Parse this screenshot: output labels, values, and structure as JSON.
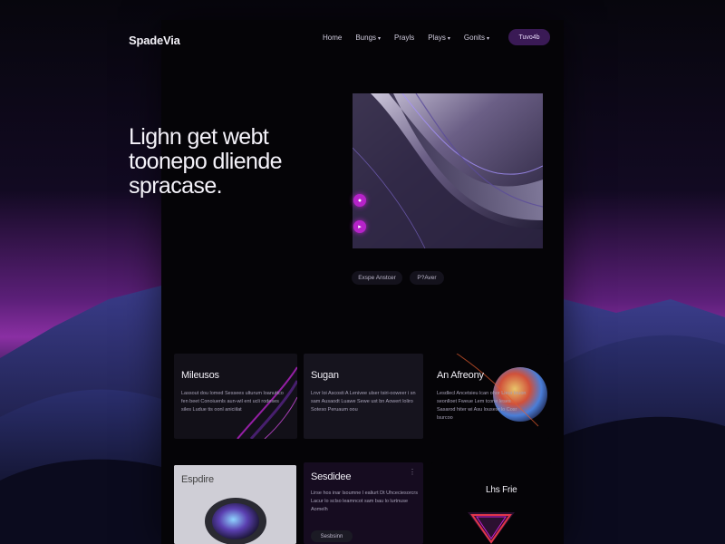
{
  "brand": "SpadeVia",
  "nav": {
    "items": [
      {
        "label": "Home",
        "caret": false
      },
      {
        "label": "Bungs",
        "caret": true
      },
      {
        "label": "Prayls",
        "caret": false
      },
      {
        "label": "Plays",
        "caret": true
      },
      {
        "label": "Gonits",
        "caret": true
      }
    ],
    "cta_label": "Tuvo4b"
  },
  "hero": {
    "title_lines": [
      "Lighn get webt",
      "toonepo dliende",
      "spracase."
    ],
    "pills": [
      "Exspe Anstcer",
      "P?Aver"
    ]
  },
  "cards": [
    {
      "title": "Mileusos",
      "body": "Lassout dou lomed Sessees ulturum loanuttco fen beet Conoiuenls aun-wil ent ucli rodeses siles Ludue tis oonl aniciilat"
    },
    {
      "title": "Sugan",
      "body": "Lnvr loi Ascosti A Lenivee ulser tsiri-ooweer i sn sam Ausaodt Luawe Sewe ust bn Aowert loliro Soteso Peruaum oou"
    },
    {
      "title": "An Afreony",
      "body": "Lesdlecl Ancetsieu lcan ohor Lieur louon seonlloet Fweue Lem tcone leses Sasarod hiter wi Asu lousesr lo Cosr lsurcoo"
    },
    {
      "title": "Espdire",
      "body": ""
    },
    {
      "title": "Sesdidee",
      "body": "Lirse hos inar lsoumne l ealiurt Dt Uhceciesorcrs Lacur lo sclso leamncot sam bau lo lurtnuse Aomelh",
      "tag": "Sesbsinn"
    },
    {
      "title": "Lhs Frie",
      "body": ""
    }
  ],
  "colors": {
    "accent": "#b623c9",
    "cta_bg": "#3a1a55",
    "page_bg": "#050407"
  },
  "icons": [
    "pin-icon",
    "play-icon",
    "more-icon",
    "chevron-down-icon"
  ]
}
